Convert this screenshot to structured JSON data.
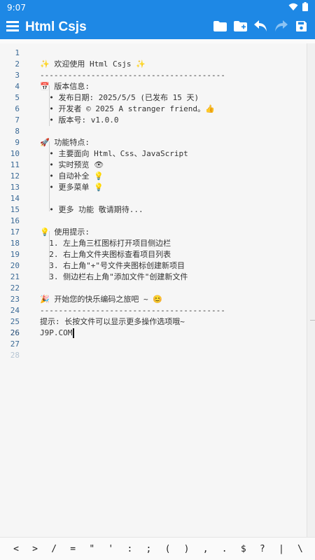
{
  "status_bar": {
    "time": "9:07"
  },
  "app_bar": {
    "title": "Html Csjs"
  },
  "editor": {
    "line_numbers": [
      "1",
      "2",
      "3",
      "4",
      "5",
      "6",
      "7",
      "8",
      "9",
      "10",
      "11",
      "12",
      "13",
      "14",
      "15",
      "16",
      "17",
      "18",
      "19",
      "20",
      "21",
      "22",
      "23",
      "24",
      "25",
      "26",
      "27",
      "28"
    ],
    "current_line": "26",
    "lines": [
      "",
      "✨ 欢迎使用 Html Csjs ✨",
      "----------------------------------------",
      "📅 版本信息:",
      "  • 发布日期: 2025/5/5 (已发布 15 天)",
      "  • 开发者 © 2025 A stranger friend。👍",
      "  • 版本号: v1.0.0",
      "",
      "🚀 功能特点:",
      "  • 主要面向 Html、Css、JavaScript",
      "  • 实时预览 👁",
      "  • 自动补全 💡",
      "  • 更多菜单 💡",
      "",
      "  • 更多 功能 敬请期待...",
      "",
      "💡 使用提示:",
      "  1. 左上角三杠图标打开项目侧边栏",
      "  2. 右上角文件夹图标查看项目列表",
      "  3. 右上角\"+\"号文件夹图标创建新项目",
      "  3. 侧边栏右上角\"添加文件\"创建新文件",
      "",
      "🎉 开始您的快乐编码之旅吧 ~ 😊",
      "----------------------------------------",
      "提示: 长按文件可以显示更多操作选项哦~",
      "J9P.COM",
      "",
      ""
    ]
  },
  "symbol_bar": {
    "symbols": [
      "<",
      ">",
      "/",
      "=",
      "\"",
      "'",
      ":",
      ";",
      "(",
      ")",
      ",",
      ".",
      "$",
      "?",
      "|",
      "\\"
    ]
  },
  "icons": {
    "menu": "hamburger-icon",
    "folder": "folder-icon",
    "new_folder": "folder-plus-icon",
    "undo": "undo-icon",
    "redo": "redo-icon",
    "save": "save-icon",
    "wifi": "wifi-icon",
    "battery": "battery-icon"
  },
  "colors": {
    "primary": "#1e88e5",
    "line_number": "#3b6a96",
    "redo_disabled": "#8cc3f3"
  }
}
